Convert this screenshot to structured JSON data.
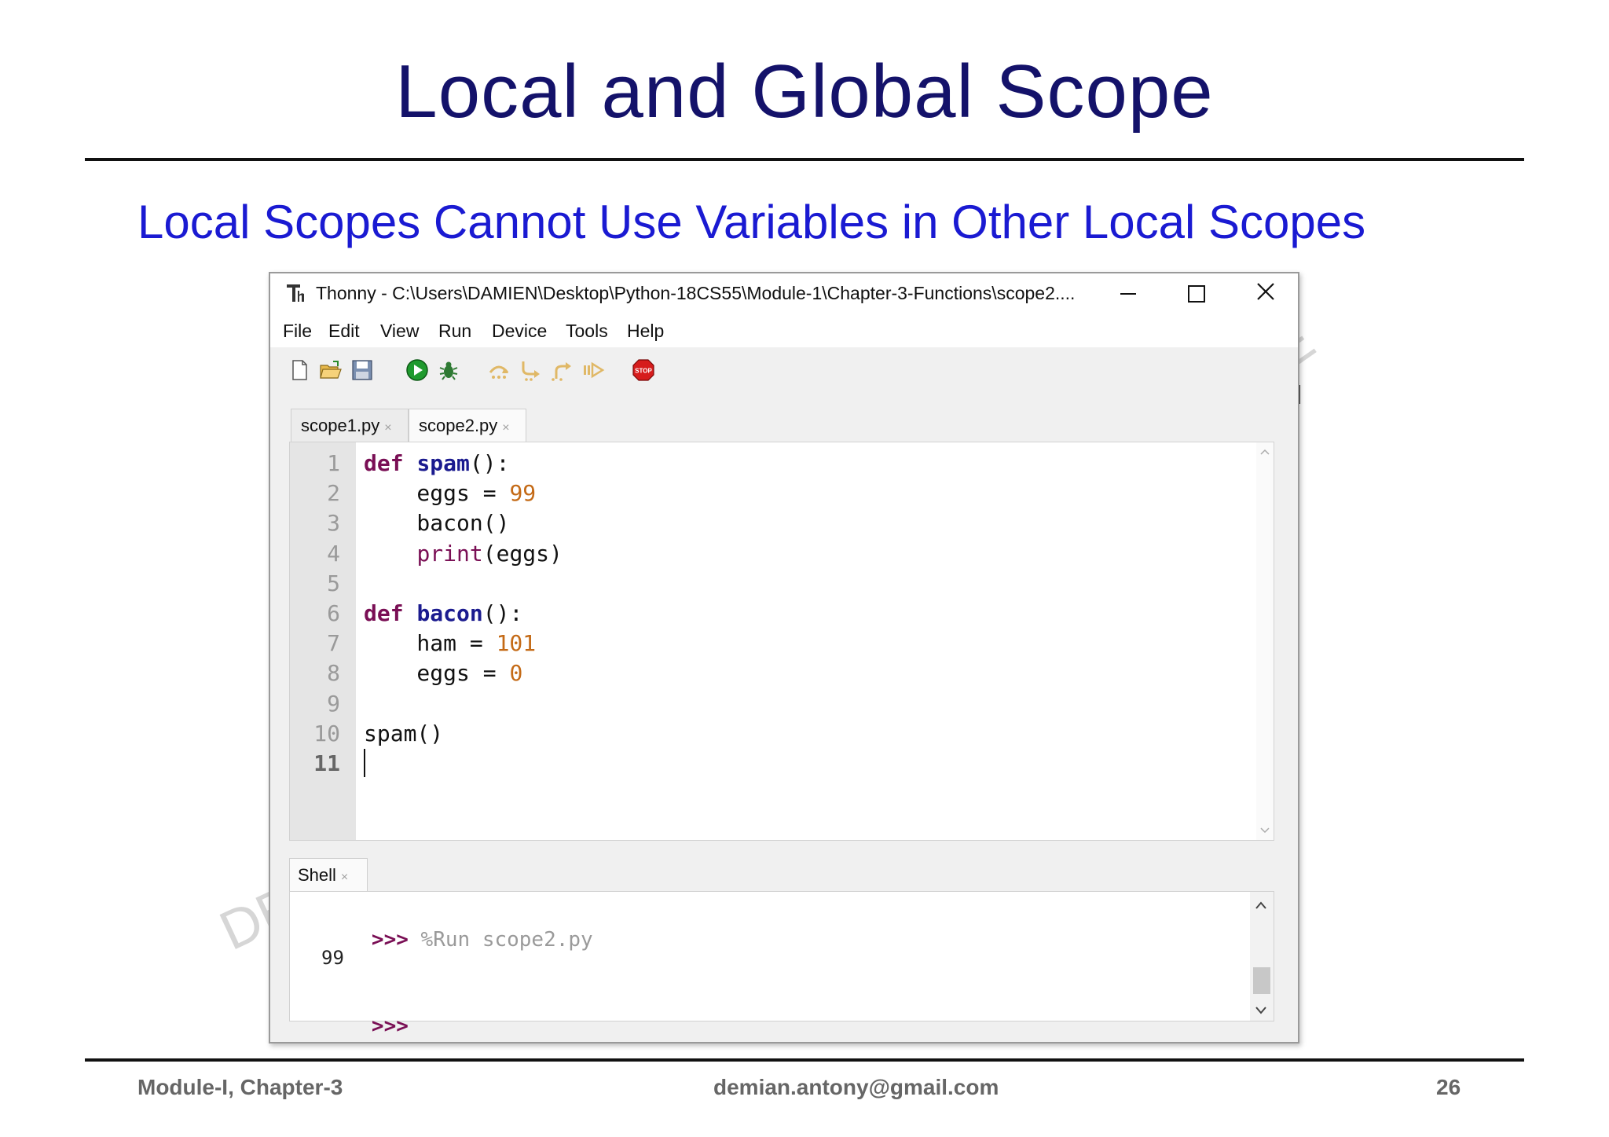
{
  "slide": {
    "title": "Local and Global Scope",
    "subtitle": "Local Scopes Cannot Use Variables in Other Local Scopes",
    "watermark_fragments": [
      "DE",
      "E"
    ]
  },
  "window": {
    "app": "Thonny",
    "title": "Thonny  -  C:\\Users\\DAMIEN\\Desktop\\Python-18CS55\\Module-1\\Chapter-3-Functions\\scope2....",
    "controls": {
      "minimize": "minimize",
      "maximize": "maximize",
      "close": "close"
    }
  },
  "menu": [
    "File",
    "Edit",
    "View",
    "Run",
    "Device",
    "Tools",
    "Help"
  ],
  "toolbar": [
    "new-file-icon",
    "open-file-icon",
    "save-icon",
    "run-icon",
    "debug-icon",
    "step-over-icon",
    "step-into-icon",
    "step-out-icon",
    "resume-icon",
    "stop-icon"
  ],
  "toolbar_labels": {
    "stop": "STOP"
  },
  "tabs": [
    {
      "label": "scope1.py",
      "active": false
    },
    {
      "label": "scope2.py",
      "active": true
    }
  ],
  "tab_close": "×",
  "editor": {
    "line_numbers": [
      "1",
      "2",
      "3",
      "4",
      "5",
      "6",
      "7",
      "8",
      "9",
      "10",
      "11"
    ],
    "current_line": 11,
    "lines": [
      [
        {
          "t": "def",
          "c": "kw"
        },
        {
          "t": " "
        },
        {
          "t": "spam",
          "c": "fn"
        },
        {
          "t": "():"
        }
      ],
      [
        {
          "t": "    eggs = "
        },
        {
          "t": "99",
          "c": "num"
        }
      ],
      [
        {
          "t": "    bacon()"
        }
      ],
      [
        {
          "t": "    "
        },
        {
          "t": "print",
          "c": "bi"
        },
        {
          "t": "(eggs)"
        }
      ],
      [],
      [
        {
          "t": "def",
          "c": "kw"
        },
        {
          "t": " "
        },
        {
          "t": "bacon",
          "c": "fn"
        },
        {
          "t": "():"
        }
      ],
      [
        {
          "t": "    ham = "
        },
        {
          "t": "101",
          "c": "num"
        }
      ],
      [
        {
          "t": "    eggs = "
        },
        {
          "t": "0",
          "c": "num"
        }
      ],
      [],
      [
        {
          "t": "spam()"
        }
      ],
      []
    ]
  },
  "shell": {
    "tab_label": "Shell",
    "prompt": ">>>",
    "command": "%Run scope2.py",
    "output": "99"
  },
  "footer": {
    "left": "Module-I, Chapter-3",
    "center": "demian.antony@gmail.com",
    "right": "26"
  },
  "colors": {
    "title": "#14126a",
    "subtitle": "#1a1ad2",
    "keyword": "#7a0f55",
    "function_name": "#1b1b8f",
    "number": "#c46a16",
    "run_green": "#1f9a2e",
    "stop_red": "#d61c1c"
  }
}
